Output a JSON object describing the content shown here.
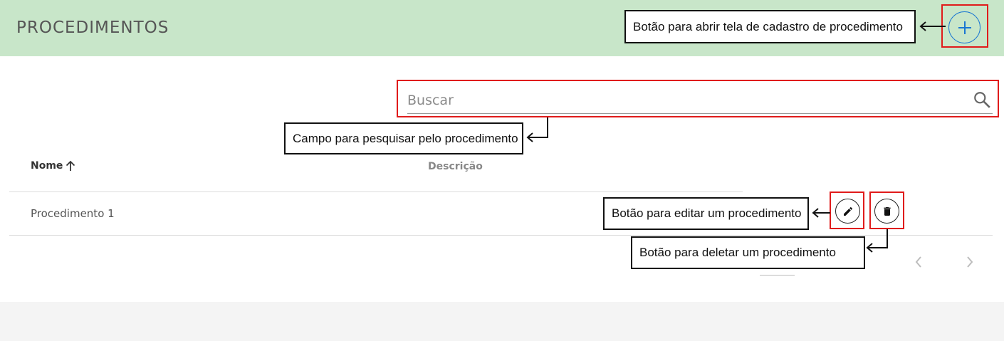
{
  "header": {
    "title": "PROCEDIMENTOS"
  },
  "search": {
    "placeholder": "Buscar"
  },
  "table": {
    "columns": [
      {
        "label": "Nome",
        "sort": "ascending"
      },
      {
        "label": "Descrição"
      }
    ],
    "rows": [
      {
        "nome": "Procedimento 1",
        "descricao": ""
      }
    ]
  },
  "annotations": {
    "add": "Botão para abrir tela de cadastro de procedimento",
    "search": "Campo para pesquisar pelo procedimento",
    "edit": "Botão para editar um procedimento",
    "delete": "Botão para deletar um procedimento"
  },
  "colors": {
    "header_bg": "#c8e6c9",
    "accent": "#1976d2",
    "highlight": "#e01b1b"
  },
  "icons": [
    "plus-icon",
    "search-icon",
    "arrow-up-icon",
    "pencil-icon",
    "trash-icon",
    "chevron-left-icon",
    "chevron-right-icon"
  ]
}
